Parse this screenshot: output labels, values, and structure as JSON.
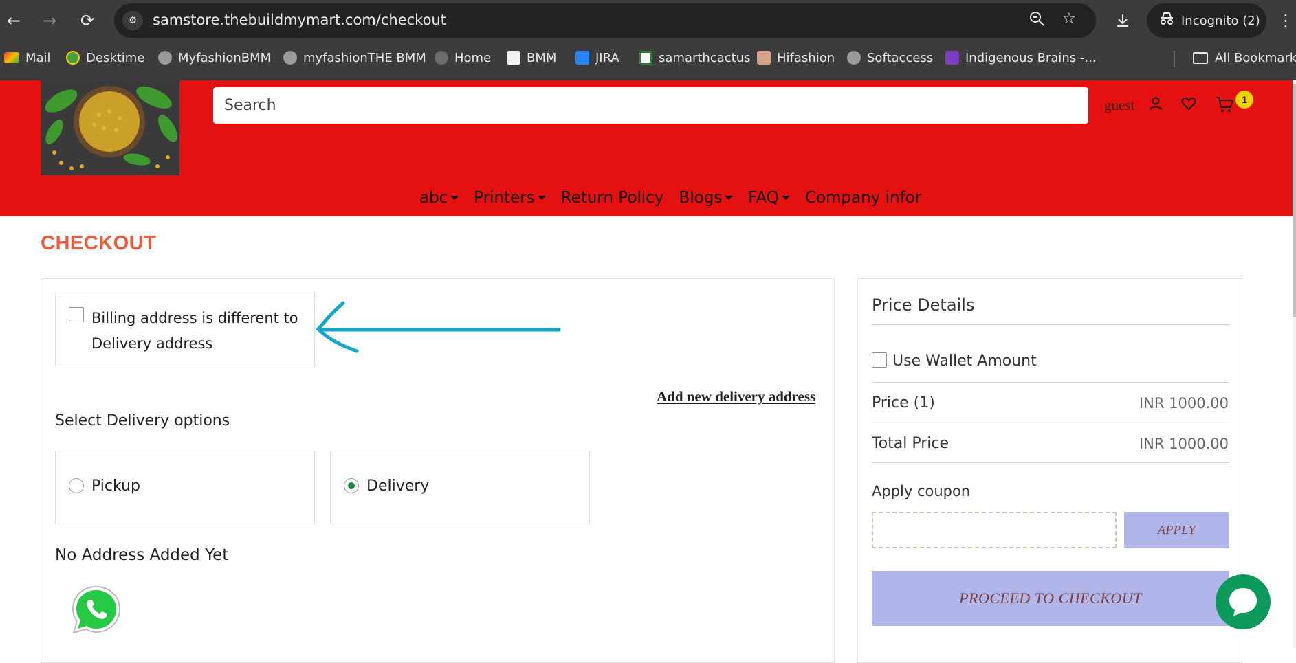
{
  "browser": {
    "url": "samstore.thebuildmymart.com/checkout",
    "incognito_label": "Incognito (2)",
    "bookmarks": [
      {
        "label": "Mail",
        "icon": "gmail-icon"
      },
      {
        "label": "Desktime",
        "icon": "desktime-icon"
      },
      {
        "label": "MyfashionBMM",
        "icon": "globe-icon"
      },
      {
        "label": "myfashionTHE BMM",
        "icon": "globe-icon"
      },
      {
        "label": "Home",
        "icon": "globe-icon"
      },
      {
        "label": "BMM",
        "icon": "bmm-icon"
      },
      {
        "label": "JIRA",
        "icon": "jira-icon"
      },
      {
        "label": "samarthcactus",
        "icon": "cactus-icon"
      },
      {
        "label": "Hifashion",
        "icon": "hifashion-icon"
      },
      {
        "label": "Softaccess",
        "icon": "globe-icon"
      },
      {
        "label": "Indigenous Brains -...",
        "icon": "indigenous-icon"
      }
    ],
    "all_bookmarks_label": "All Bookmarks"
  },
  "header": {
    "search_placeholder": "Search",
    "user_label": "guest",
    "cart_count": "1",
    "nav": [
      {
        "label": "abc",
        "dropdown": true
      },
      {
        "label": "Printers",
        "dropdown": true
      },
      {
        "label": "Return Policy",
        "dropdown": false
      },
      {
        "label": "Blogs",
        "dropdown": true
      },
      {
        "label": "FAQ",
        "dropdown": true
      },
      {
        "label": "Company infor",
        "dropdown": false
      }
    ],
    "brand_color": "#e51010"
  },
  "checkout": {
    "title": "CHECKOUT",
    "billing_checkbox_label": "Billing address is different to Delivery address",
    "add_address_link": "Add new delivery address",
    "delivery_heading": "Select Delivery options",
    "options": [
      {
        "label": "Pickup",
        "selected": false
      },
      {
        "label": "Delivery",
        "selected": true
      }
    ],
    "no_address_text": "No Address Added Yet"
  },
  "price_details": {
    "title": "Price Details",
    "wallet_label": "Use Wallet Amount",
    "price_label": "Price (1)",
    "price_value": "INR 1000.00",
    "total_label": "Total Price",
    "total_value": "INR 1000.00",
    "coupon_label": "Apply coupon",
    "apply_button": "APPLY",
    "proceed_button": "PROCEED TO CHECKOUT",
    "button_color": "#b1b6ea"
  }
}
